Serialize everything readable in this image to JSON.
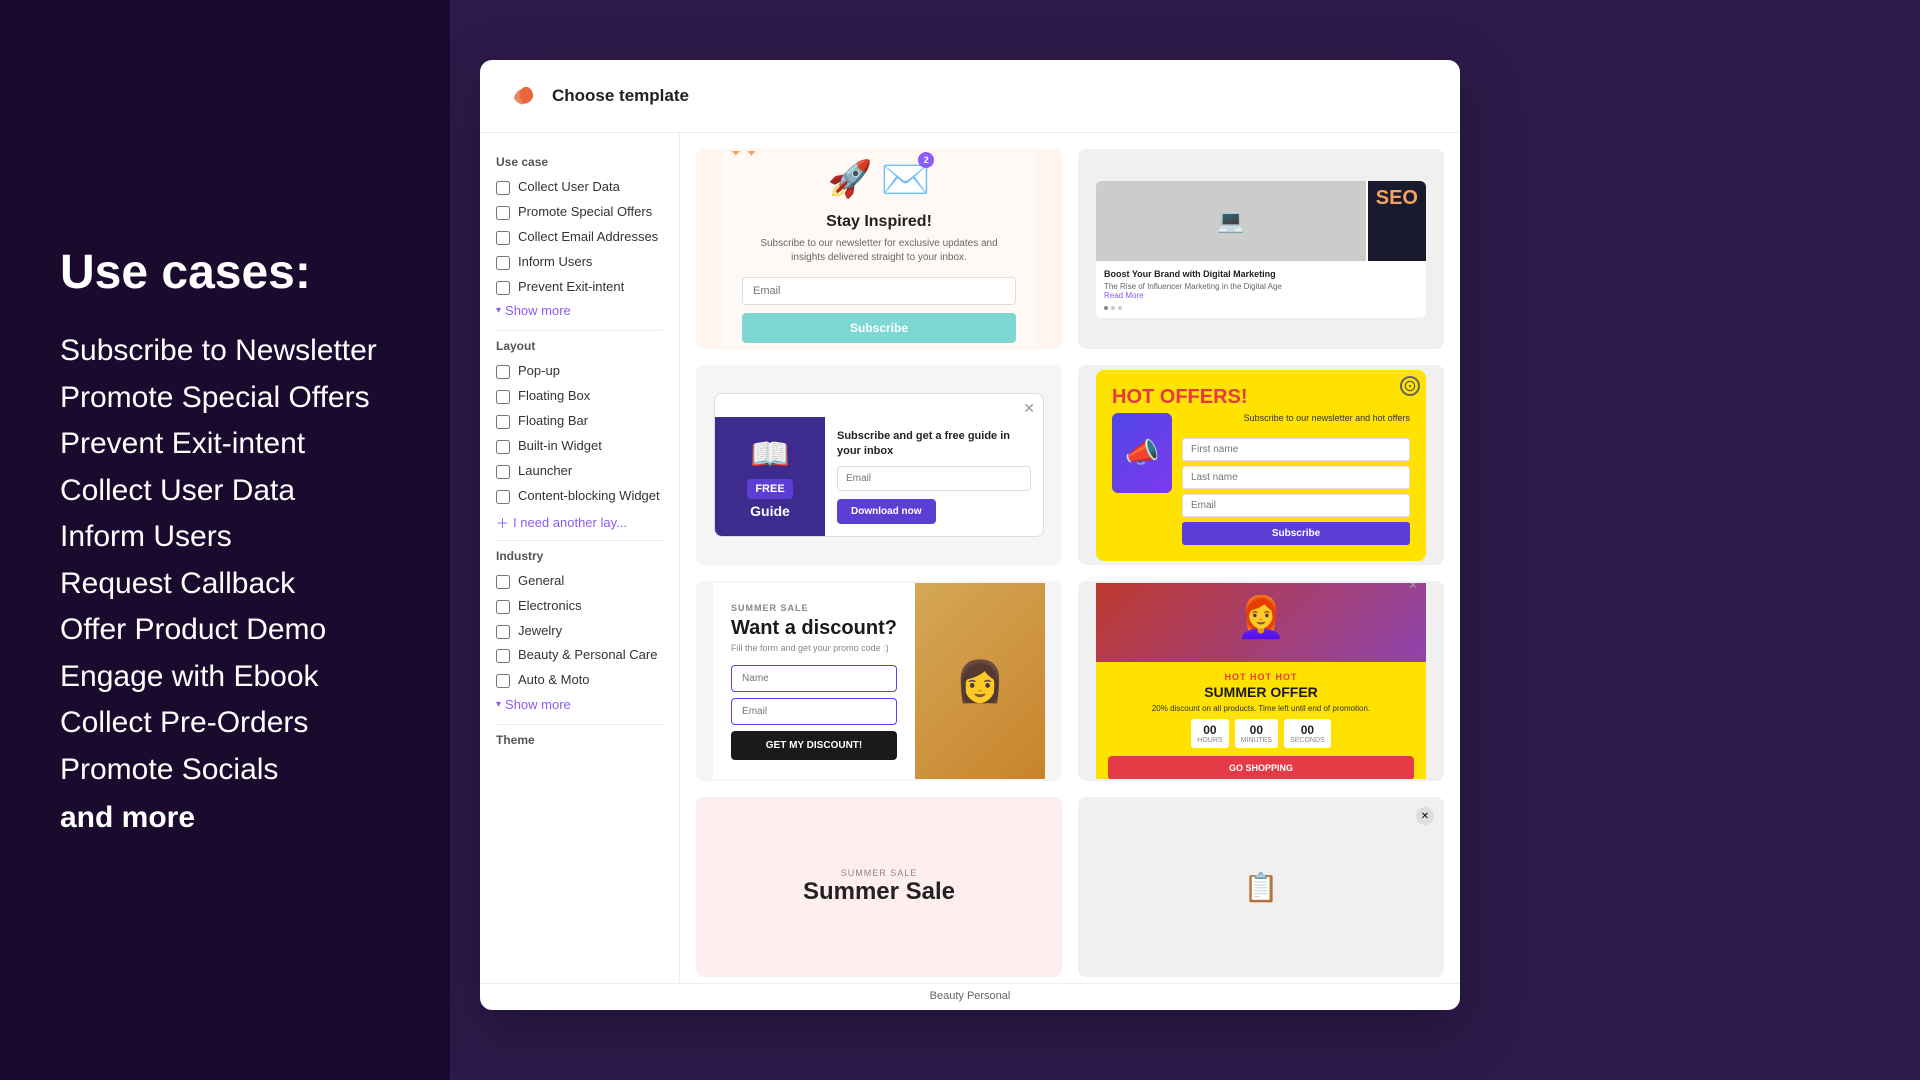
{
  "left": {
    "title": "Use cases:",
    "items": [
      "Subscribe to Newsletter",
      "Promote Special Offers",
      "Prevent Exit-intent",
      "Collect User Data",
      "Inform Users",
      "Request Callback",
      "Offer Product Demo",
      "Engage with Ebook",
      "Collect Pre-Orders",
      "Promote Socials"
    ],
    "and_more": "and more"
  },
  "modal": {
    "title": "Choose template",
    "filters": {
      "use_case_label": "Use case",
      "use_case_items": [
        "Collect User Data",
        "Promote Special Offers",
        "Collect Email Addresses",
        "Inform Users",
        "Prevent Exit-intent"
      ],
      "show_more_label": "Show more",
      "layout_label": "Layout",
      "layout_items": [
        "Pop-up",
        "Floating Box",
        "Floating Bar",
        "Built-in Widget",
        "Launcher",
        "Content-blocking Widget"
      ],
      "add_layout_label": "I need another lay...",
      "industry_label": "Industry",
      "industry_items": [
        "General",
        "Electronics",
        "Jewelry",
        "Beauty & Personal Care",
        "Auto & Moto"
      ],
      "industry_show_more": "Show more",
      "theme_label": "Theme"
    },
    "templates": [
      {
        "id": "newsletter",
        "type": "newsletter",
        "badge": "2",
        "title": "Stay Inspired!",
        "description": "Subscribe to our newsletter for exclusive updates and insights delivered straight to your inbox.",
        "input_placeholder": "Email",
        "button_label": "Subscribe"
      },
      {
        "id": "blog",
        "type": "blog",
        "headline": "Boost Your Brand with Digital Marketing",
        "subline": "The Rise of Influencer Marketing in the Digital Age",
        "read_more1": "Read More",
        "read_more2": "Read More"
      },
      {
        "id": "guide",
        "type": "guide",
        "tagline": "Subscribe and get a free guide in your inbox",
        "free_label": "FREE",
        "guide_label": "Guide",
        "input_placeholder": "Email",
        "button_label": "Download now"
      },
      {
        "id": "hot_offers",
        "type": "hot_offers",
        "title": "HOT OFFERS!",
        "subtitle": "Subscribe to our newsletter and hot offers",
        "fields": [
          "First name",
          "Last name",
          "Email"
        ],
        "button_label": "Subscribe"
      },
      {
        "id": "discount",
        "type": "discount",
        "tag": "SUMMER SALE",
        "title": "Want a discount?",
        "subtitle": "Fill the form and get your promo code :)",
        "fields": [
          "Name",
          "Email"
        ],
        "button_label": "GET MY DISCOUNT!"
      },
      {
        "id": "summer_offer",
        "type": "summer_offer",
        "tag": "HOT HOT HOT",
        "title": "SUMMER OFFER",
        "description": "20% discount on all products. Time left until end of promotion.",
        "countdown": {
          "hours": "00",
          "minutes": "00",
          "seconds": "00"
        },
        "button_label": "GO SHOPPING"
      },
      {
        "id": "summer_sale2",
        "type": "summer_sale2",
        "tag": "SUMMER SALE",
        "title": "Summer Sale"
      },
      {
        "id": "extra",
        "type": "extra"
      }
    ],
    "beauty_personal_label": "Beauty Personal"
  }
}
